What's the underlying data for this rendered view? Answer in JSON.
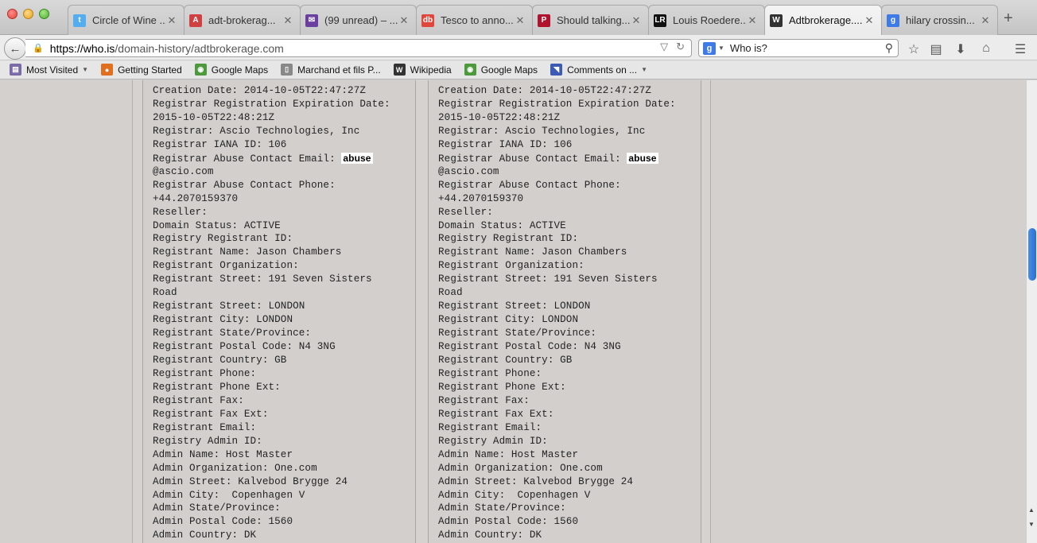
{
  "window": {
    "tabs": [
      {
        "title": "Circle of Wine ...",
        "icon": "twitter-icon",
        "color": "#55acee",
        "glyph": "t"
      },
      {
        "title": "adt-brokerag...",
        "icon": "adt-icon",
        "color": "#d04040",
        "glyph": "A"
      },
      {
        "title": "(99 unread) – ...",
        "icon": "mail-icon",
        "color": "#6b3fa0",
        "glyph": "✉"
      },
      {
        "title": "Tesco to anno...",
        "icon": "db-icon",
        "color": "#e0463c",
        "glyph": "db"
      },
      {
        "title": "Should talking...",
        "icon": "p-icon",
        "color": "#b0132d",
        "glyph": "P"
      },
      {
        "title": "Louis Roedere...",
        "icon": "lrwa-icon",
        "color": "#111111",
        "glyph": "LR"
      },
      {
        "title": "Adtbrokerage....",
        "icon": "whois-icon",
        "color": "#333333",
        "glyph": "W"
      },
      {
        "title": "hilary crossin...",
        "icon": "google-icon",
        "color": "#3f7be6",
        "glyph": "g"
      }
    ],
    "new_tab": "+"
  },
  "nav": {
    "url_host": "https://who.is",
    "url_rest": "/domain-history/adtbrokerage.com",
    "search_value": "Who is?"
  },
  "bookmarks": [
    {
      "label": "Most Visited",
      "icon": "folder-icon",
      "color": "#7a6aa8",
      "dropdown": true
    },
    {
      "label": "Getting Started",
      "icon": "firefox-icon",
      "color": "#e07020"
    },
    {
      "label": "Google Maps",
      "icon": "maps-icon",
      "color": "#4d9a3d"
    },
    {
      "label": "Marchand et fils P...",
      "icon": "page-icon",
      "color": "#888888"
    },
    {
      "label": "Wikipedia",
      "icon": "wikipedia-icon",
      "color": "#333333"
    },
    {
      "label": "Google Maps",
      "icon": "maps-icon",
      "color": "#4d9a3d"
    },
    {
      "label": "Comments on ...",
      "icon": "rss-icon",
      "color": "#3b5bb5",
      "dropdown": true
    }
  ],
  "whois_left": {
    "lines": [
      "Creation Date: 2014-10-05T22:47:27Z",
      "Registrar Registration Expiration Date:",
      "2015-10-05T22:48:21Z",
      "Registrar: Ascio Technologies, Inc",
      "Registrar IANA ID: 106",
      "Registrar Abuse Contact Email: ",
      "@ascio.com",
      "Registrar Abuse Contact Phone:",
      "+44.2070159370",
      "Reseller:",
      "Domain Status: ACTIVE",
      "Registry Registrant ID:",
      "Registrant Name: Jason Chambers",
      "Registrant Organization:",
      "Registrant Street: 191 Seven Sisters",
      "Road",
      "Registrant Street: LONDON",
      "Registrant City: LONDON",
      "Registrant State/Province:",
      "Registrant Postal Code: N4 3NG",
      "Registrant Country: GB",
      "Registrant Phone:",
      "Registrant Phone Ext:",
      "Registrant Fax:",
      "Registrant Fax Ext:",
      "Registrant Email:",
      "Registry Admin ID:",
      "Admin Name: Host Master",
      "Admin Organization: One.com",
      "Admin Street: Kalvebod Brygge 24",
      "Admin City:  Copenhagen V",
      "Admin State/Province:",
      "Admin Postal Code: 1560",
      "Admin Country: DK"
    ],
    "highlight": "abuse"
  },
  "whois_right": {
    "lines": [
      "Creation Date: 2014-10-05T22:47:27Z",
      "Registrar Registration Expiration Date:",
      "2015-10-05T22:48:21Z",
      "Registrar: Ascio Technologies, Inc",
      "Registrar IANA ID: 106",
      "Registrar Abuse Contact Email: ",
      "@ascio.com",
      "Registrar Abuse Contact Phone:",
      "+44.2070159370",
      "Reseller:",
      "Domain Status: ACTIVE",
      "Registry Registrant ID:",
      "Registrant Name: Jason Chambers",
      "Registrant Organization:",
      "Registrant Street: 191 Seven Sisters",
      "Road",
      "Registrant Street: LONDON",
      "Registrant City: LONDON",
      "Registrant State/Province:",
      "Registrant Postal Code: N4 3NG",
      "Registrant Country: GB",
      "Registrant Phone:",
      "Registrant Phone Ext:",
      "Registrant Fax:",
      "Registrant Fax Ext:",
      "Registrant Email:",
      "Registry Admin ID:",
      "Admin Name: Host Master",
      "Admin Organization: One.com",
      "Admin Street: Kalvebod Brygge 24",
      "Admin City:  Copenhagen V",
      "Admin State/Province:",
      "Admin Postal Code: 1560",
      "Admin Country: DK"
    ],
    "highlight": "abuse"
  }
}
